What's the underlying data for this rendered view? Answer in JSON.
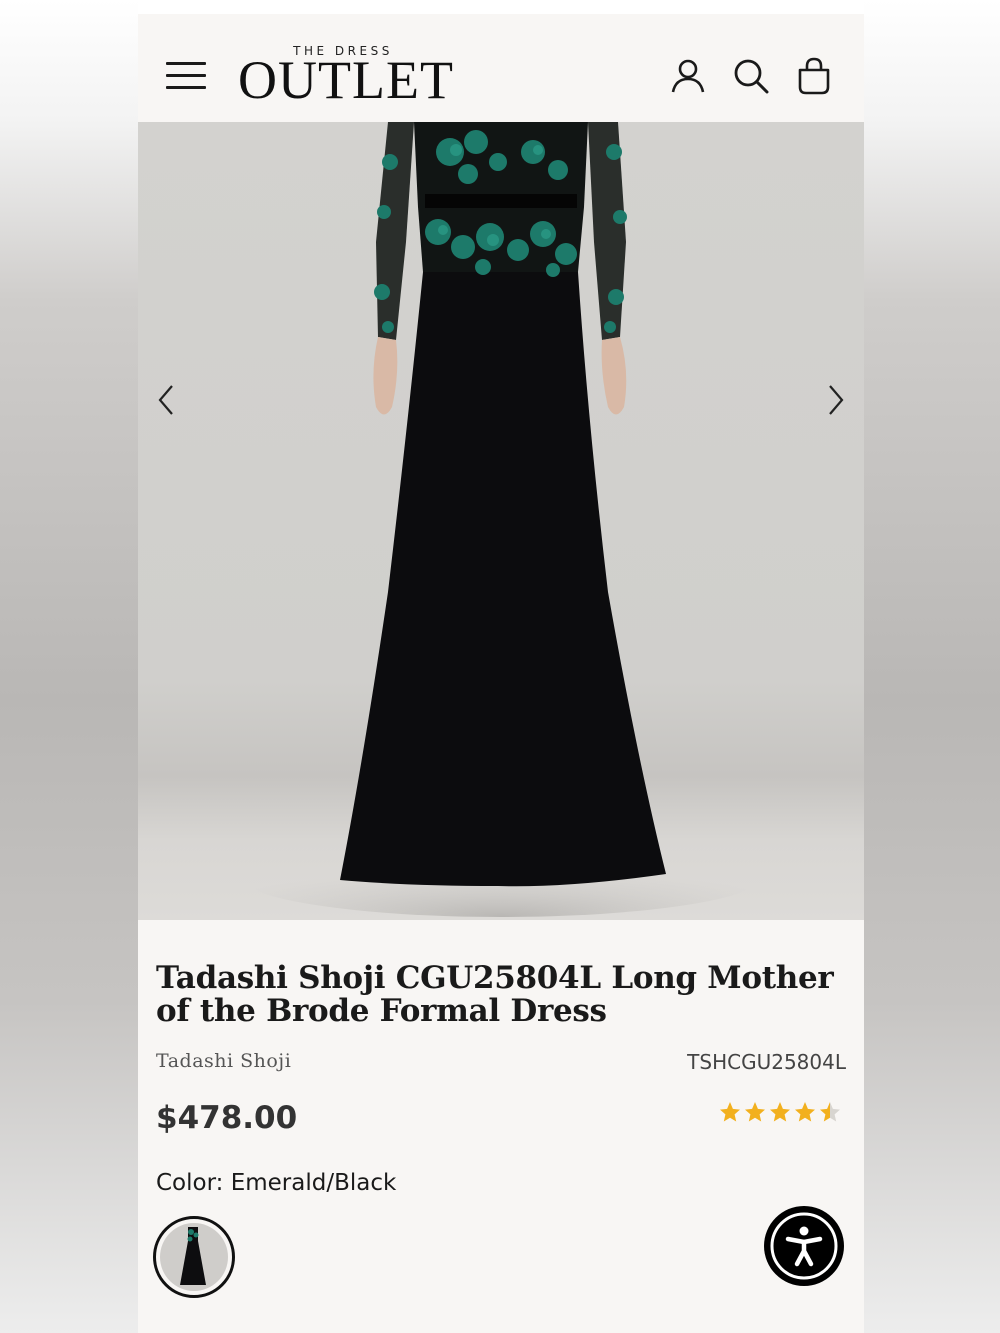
{
  "header": {
    "menu_icon": "hamburger-menu-icon",
    "logo_top": "THE DRESS",
    "logo_main": "OUTLET",
    "icons": [
      "account-icon",
      "search-icon",
      "shopping-bag-icon"
    ]
  },
  "gallery": {
    "image_alt": "Tadashi Shoji long gown with emerald lace bodice and black crepe skirt",
    "prev_icon": "chevron-left-icon",
    "next_icon": "chevron-right-icon"
  },
  "product": {
    "title": "Tadashi Shoji CGU25804L Long Mother of the Brode Formal Dress",
    "brand": "Tadashi Shoji",
    "sku": "TSHCGU25804L",
    "price": "$478.00",
    "rating": 4.5,
    "rating_max": 5,
    "color_label": "Color:",
    "color_value": "Emerald/Black"
  },
  "colors": {
    "accent_star": "#f2b01e",
    "emerald": "#1d7a6a",
    "text": "#1a1a1a"
  },
  "accessibility": {
    "icon": "accessibility-icon"
  }
}
